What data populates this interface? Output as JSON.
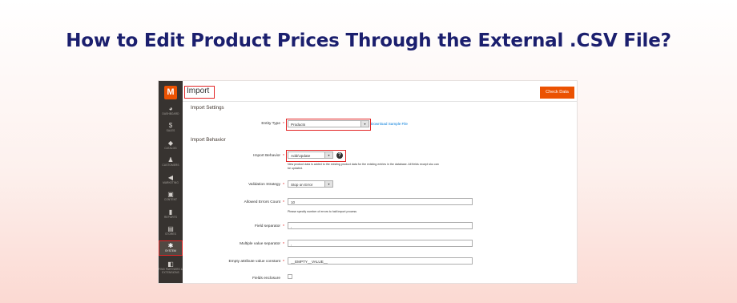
{
  "headline": "How to Edit Product Prices Through the External .CSV File?",
  "sidebar": {
    "logo": "M",
    "items": [
      {
        "label": "DASHBOARD",
        "icon": "speedometer-icon",
        "glyph": "◕"
      },
      {
        "label": "SALES",
        "icon": "dollar-icon",
        "glyph": "$"
      },
      {
        "label": "CATALOG",
        "icon": "cube-icon",
        "glyph": "◆"
      },
      {
        "label": "CUSTOMERS",
        "icon": "person-icon",
        "glyph": "♟"
      },
      {
        "label": "MARKETING",
        "icon": "megaphone-icon",
        "glyph": "◀"
      },
      {
        "label": "CONTENT",
        "icon": "content-icon",
        "glyph": "▣"
      },
      {
        "label": "REPORTS",
        "icon": "bar-chart-icon",
        "glyph": "▮"
      },
      {
        "label": "STORES",
        "icon": "store-icon",
        "glyph": "▤"
      },
      {
        "label": "SYSTEM",
        "icon": "gear-icon",
        "glyph": "✱"
      },
      {
        "label": "FIND PARTNERS & EXTENSIONS",
        "icon": "extensions-icon",
        "glyph": "◧"
      }
    ]
  },
  "page": {
    "title": "Import",
    "check_button": "Check Data"
  },
  "import_settings": {
    "heading": "Import Settings",
    "entity_type_label": "Entity Type",
    "entity_type_value": "Products",
    "download_link": "Download Sample File"
  },
  "import_behavior": {
    "heading": "Import Behavior",
    "behavior_label": "Import Behavior",
    "behavior_value": "Add/Update",
    "behavior_note_1": "New product data is added to the existing product data for the existing entries in the database. All fields except sku can",
    "behavior_note_2": "be updated.",
    "validation_label": "Validation Strategy",
    "validation_value": "Stop on Error",
    "errors_label": "Allowed Errors Count",
    "errors_value": "10",
    "errors_note": "Please specify number of errors to halt import process",
    "field_sep_label": "Field separator",
    "field_sep_value": ",",
    "multi_sep_label": "Multiple value separator",
    "multi_sep_value": ",",
    "empty_attr_label": "Empty attribute value constant",
    "empty_attr_value": "__EMPTY__VALUE__",
    "enclosure_label": "Fields enclosure"
  }
}
